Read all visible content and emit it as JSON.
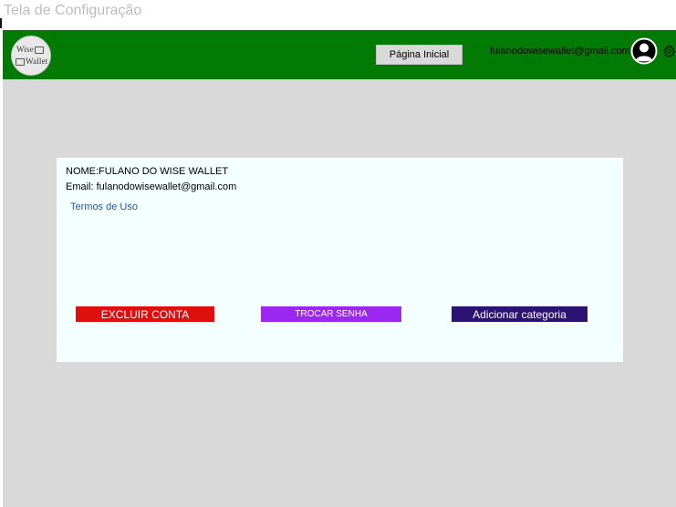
{
  "frame": {
    "title": "Tela de Configuração"
  },
  "header": {
    "logo": {
      "line1": "Wise",
      "line2": "Wallet"
    },
    "home_button": "Página Inicial",
    "user_email": "fulanodowisewallet@gmail.com",
    "icons": [
      "user-avatar-icon",
      "gear-icon"
    ]
  },
  "account": {
    "name": "NOME:FULANO DO WISE WALLET",
    "email": "Email: fulanodowisewallet@gmail.com",
    "terms_link": "Termos de Uso"
  },
  "actions": {
    "delete_account": "EXCLUIR CONTA",
    "change_password": "TROCAR SENHA",
    "add_category": "Adicionar categoria"
  },
  "colors": {
    "header_bg": "#037a03",
    "screen_bg": "#d9d9d9",
    "card_bg": "#f4ffff",
    "delete_button": "#e00f0f",
    "password_button": "#9c27f0",
    "category_button": "#2c1273",
    "link": "#2a55a0"
  }
}
